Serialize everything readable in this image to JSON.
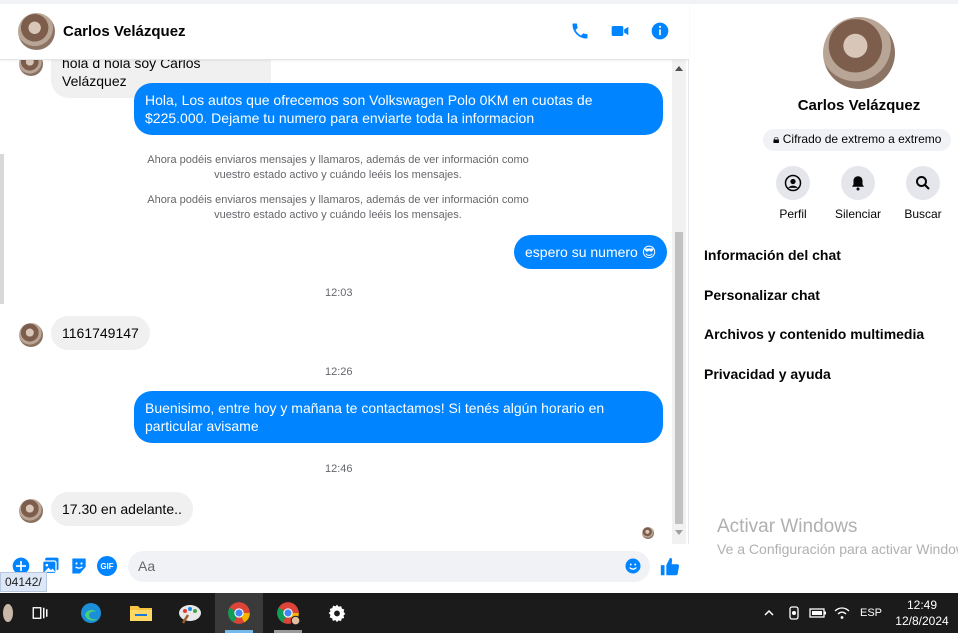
{
  "chat": {
    "contact_name": "Carlos Velázquez",
    "header_icons": [
      "phone-icon",
      "video-camera-icon",
      "info-icon"
    ],
    "messages": [
      {
        "type": "in",
        "text": "hola d hola soy Carlos Velázquez"
      },
      {
        "type": "out",
        "text": "Hola, Los autos que ofrecemos son Volkswagen Polo 0KM en cuotas de $225.000. Dejame tu numero para enviarte toda la informacion"
      },
      {
        "type": "system",
        "text": "Ahora podéis enviaros mensajes y llamaros, además de ver información como vuestro estado activo y cuándo leéis los mensajes."
      },
      {
        "type": "system",
        "text": "Ahora podéis enviaros mensajes y llamaros, además de ver información como vuestro estado activo y cuándo leéis los mensajes."
      },
      {
        "type": "out",
        "text": "espero su numero 😎"
      },
      {
        "type": "time",
        "text": "12:03"
      },
      {
        "type": "in",
        "text": "1161749147"
      },
      {
        "type": "time",
        "text": "12:26"
      },
      {
        "type": "out",
        "text": "Buenisimo, entre hoy y mañana te contactamos! Si tenés algún horario en particular avisame"
      },
      {
        "type": "time",
        "text": "12:46"
      },
      {
        "type": "in",
        "text": "17.30 en adelante.."
      }
    ],
    "composer": {
      "placeholder": "Aa",
      "icons": [
        "plus-icon",
        "photo-icon",
        "sticker-icon",
        "gif-icon",
        "emoji-icon",
        "like-icon"
      ],
      "gif_label": "GIF"
    },
    "status_url": "04142/"
  },
  "info_panel": {
    "name": "Carlos Velázquez",
    "encryption": "Cifrado de extremo a extremo",
    "actions": [
      "Perfil",
      "Silenciar",
      "Buscar"
    ],
    "menu": [
      "Información del chat",
      "Personalizar chat",
      "Archivos y contenido multimedia",
      "Privacidad y ayuda"
    ],
    "watermark_title": "Activar Windows",
    "watermark_sub": "Ve a Configuración para activar Windows."
  },
  "taskbar": {
    "apps": [
      "task-view-icon",
      "edge-icon",
      "file-explorer-icon",
      "paint-icon",
      "chrome-icon",
      "chrome-profile-icon",
      "settings-icon"
    ],
    "language": "ESP",
    "time": "12:49",
    "date": "12/8/2024"
  },
  "colors": {
    "accent": "#0084ff",
    "incoming_bubble": "#f0f0f0",
    "taskbar": "#1b1b1b"
  }
}
